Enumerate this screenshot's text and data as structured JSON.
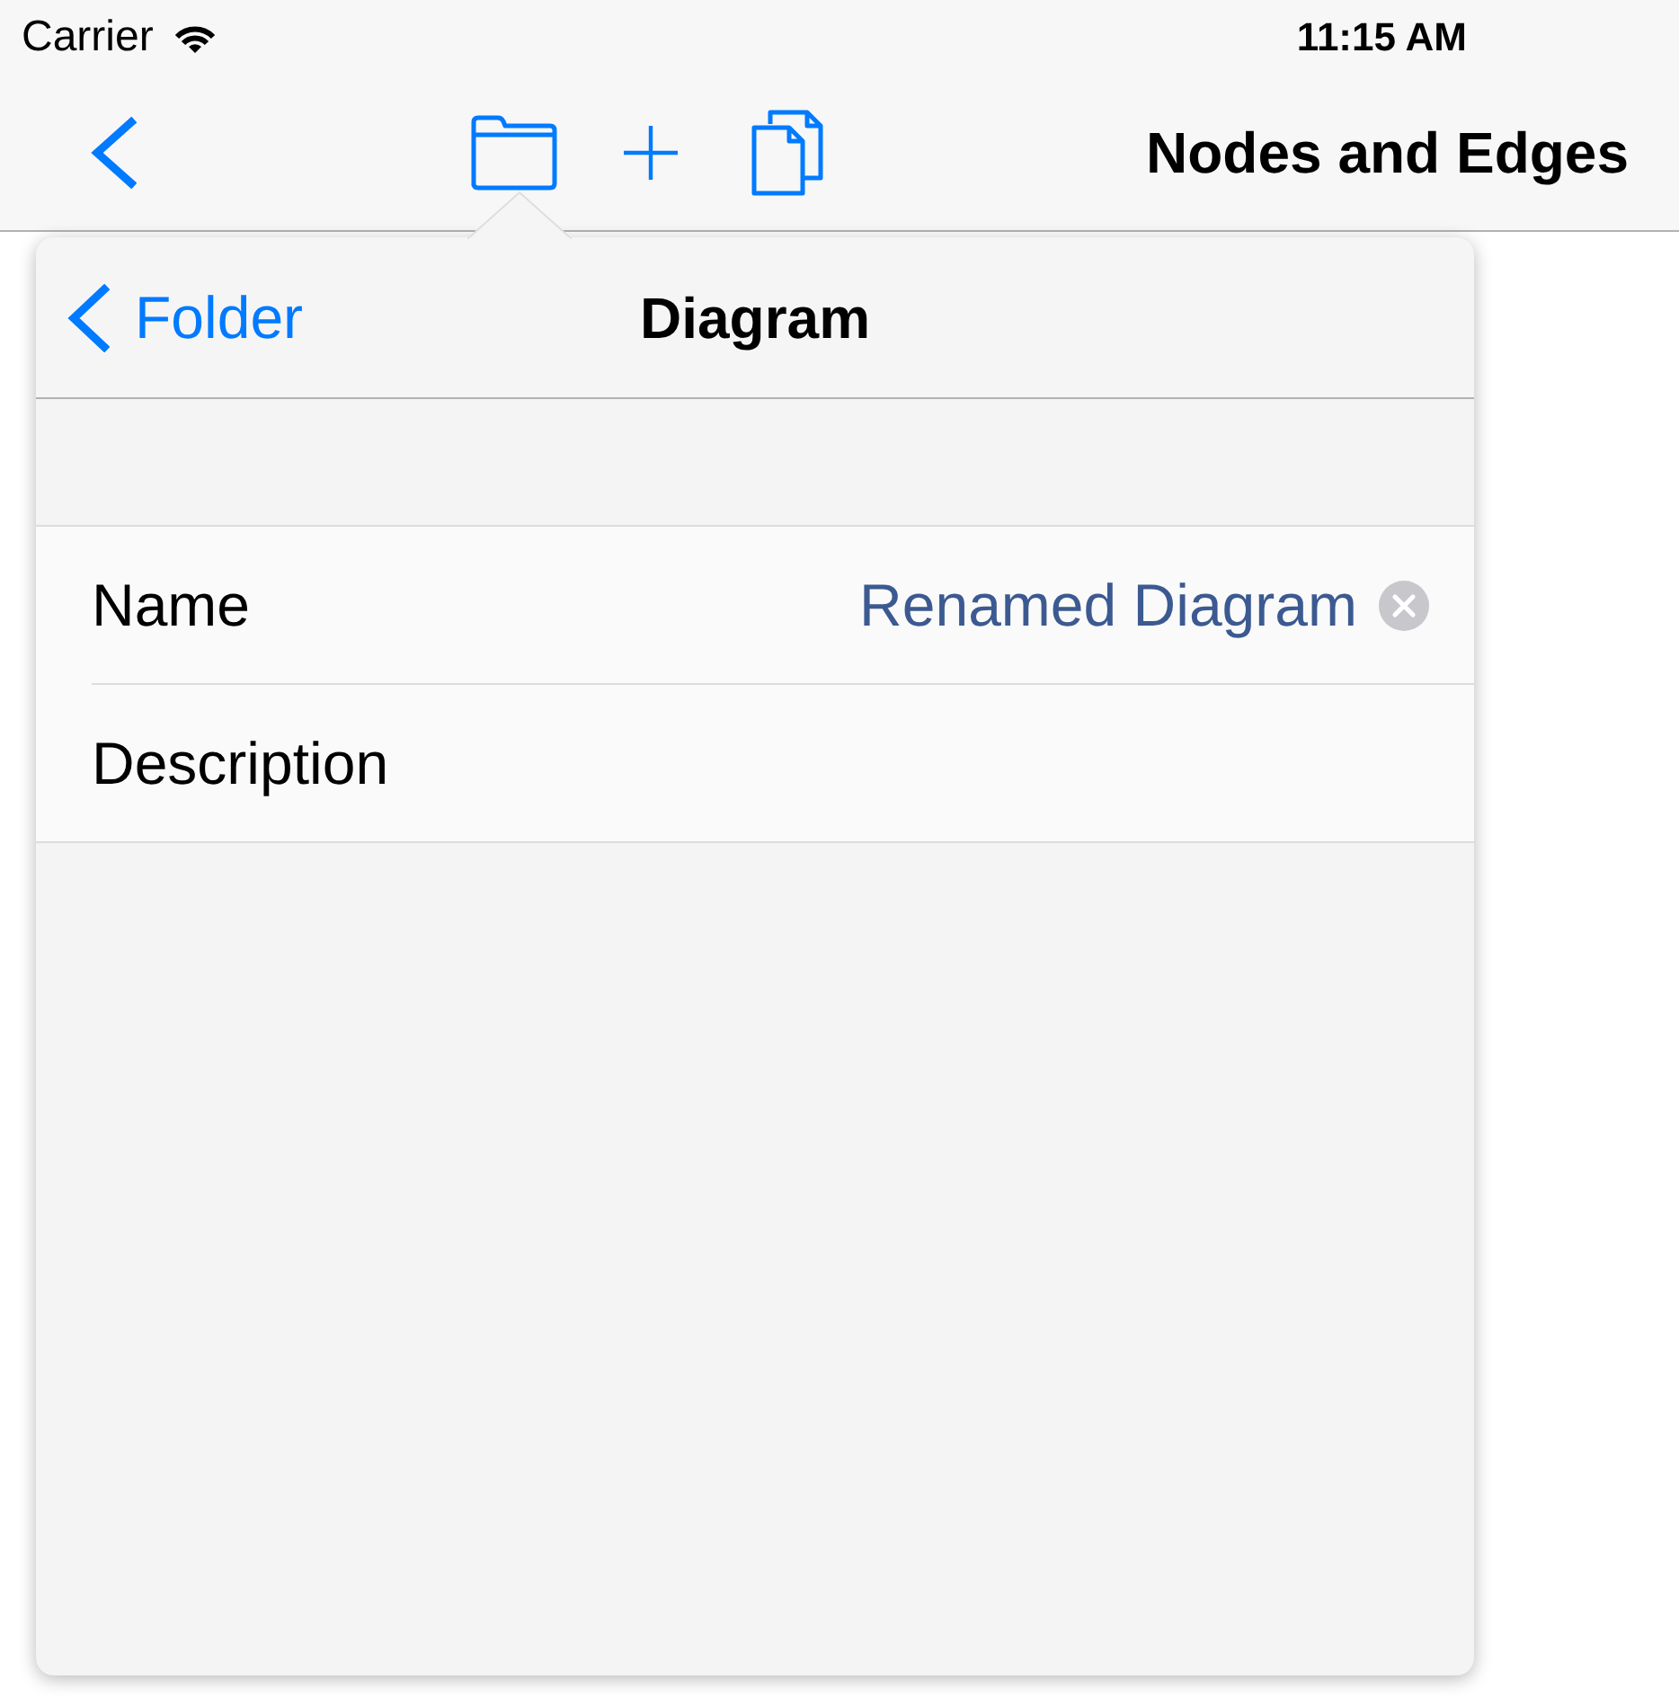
{
  "status_bar": {
    "carrier": "Carrier",
    "time": "11:15 AM"
  },
  "nav_bar": {
    "title": "Nodes and Edges"
  },
  "popover": {
    "back_label": "Folder",
    "title": "Diagram",
    "rows": [
      {
        "kind": "text_field",
        "label": "Name",
        "value": "Renamed Diagram",
        "clear_button": true
      },
      {
        "kind": "label",
        "label": "Description"
      }
    ]
  }
}
